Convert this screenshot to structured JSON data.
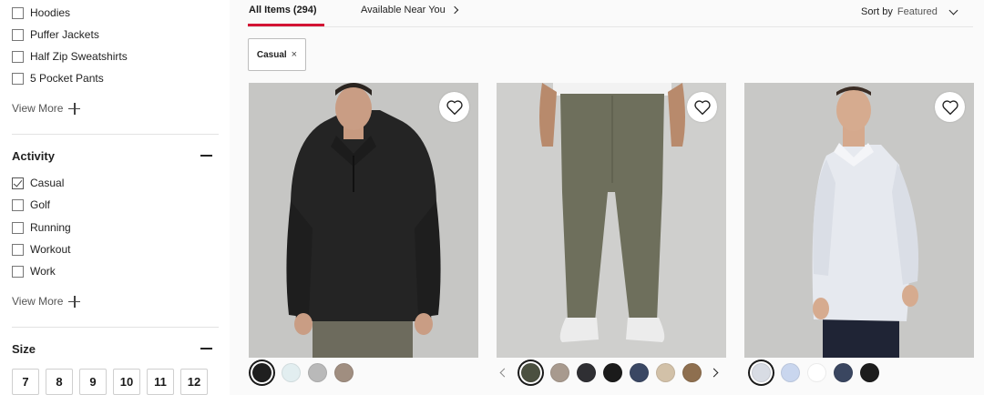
{
  "filters": {
    "category_items": [
      {
        "label": "Hoodies",
        "checked": false
      },
      {
        "label": "Puffer Jackets",
        "checked": false
      },
      {
        "label": "Half Zip Sweatshirts",
        "checked": false
      },
      {
        "label": "5 Pocket Pants",
        "checked": false
      }
    ],
    "view_more_label": "View More",
    "activity": {
      "title": "Activity",
      "items": [
        {
          "label": "Casual",
          "checked": true
        },
        {
          "label": "Golf",
          "checked": false
        },
        {
          "label": "Running",
          "checked": false
        },
        {
          "label": "Workout",
          "checked": false
        },
        {
          "label": "Work",
          "checked": false
        }
      ],
      "view_more_label": "View More"
    },
    "size": {
      "title": "Size",
      "options": [
        "7",
        "8",
        "9",
        "10",
        "11",
        "12"
      ]
    }
  },
  "tabs": {
    "all_items": "All Items (294)",
    "available_near_you": "Available Near You"
  },
  "sort": {
    "label": "Sort by",
    "value": "Featured"
  },
  "active_filters": [
    {
      "label": "Casual",
      "remove_icon": "×"
    }
  ],
  "products": [
    {
      "name": "half-zip-sweatshirt",
      "image_bg": "#c6c6c4",
      "swatches": [
        "#1f1f1f",
        "#e2eef0",
        "#b9b9b9",
        "#a08e80"
      ],
      "selected_swatch": 0
    },
    {
      "name": "olive-pants",
      "image_bg": "#cfcfcd",
      "swatches": [
        "#4b5040",
        "#a89a8e",
        "#2f2f33",
        "#1b1b1b",
        "#3a4763",
        "#d2c1a8",
        "#8e6f4f"
      ],
      "selected_swatch": 0
    },
    {
      "name": "button-up-shirt",
      "image_bg": "#c8c8c6",
      "swatches": [
        "#d8dce4",
        "#c9d6ee",
        "#ffffff",
        "#3a4660",
        "#1c1c1c"
      ],
      "selected_swatch": 0
    }
  ],
  "colors": {
    "accent": "#d31334"
  }
}
